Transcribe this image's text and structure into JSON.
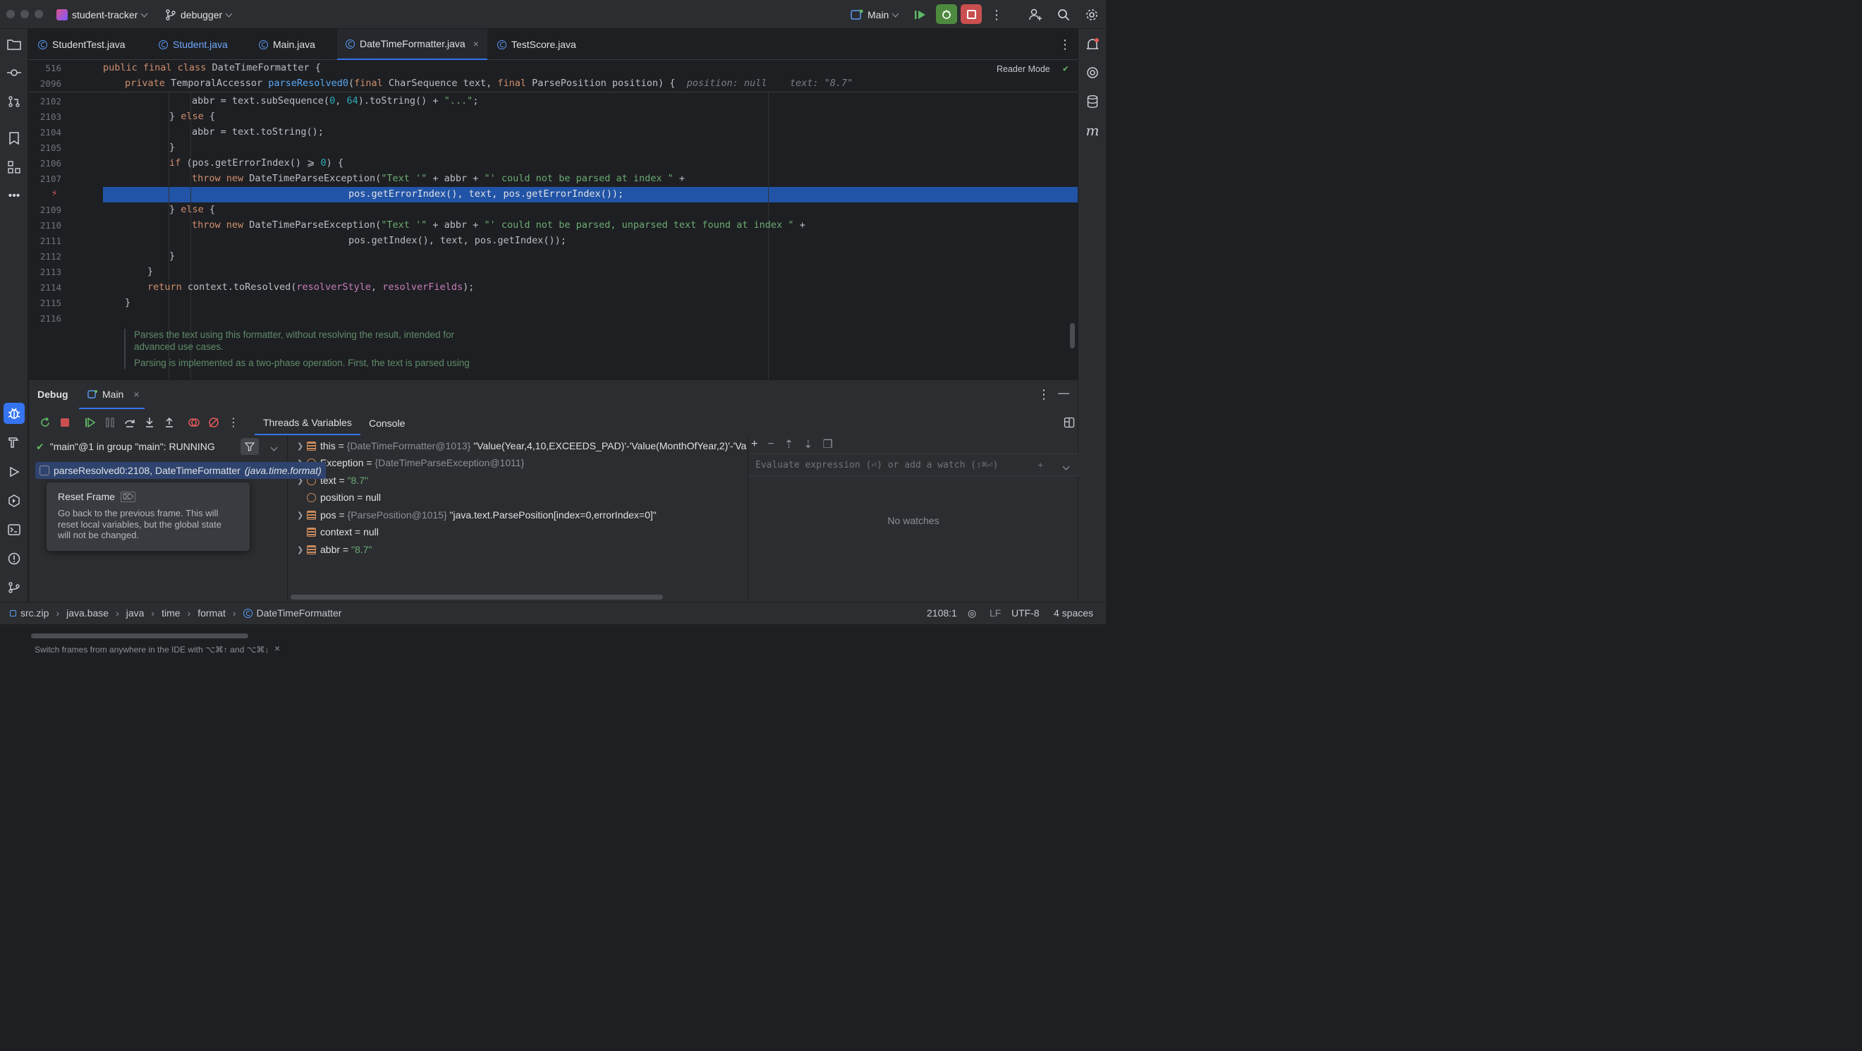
{
  "titlebar": {
    "project": "student-tracker",
    "branch": "debugger",
    "run_config": "Main"
  },
  "tabs": [
    {
      "label": "StudentTest.java",
      "active": false
    },
    {
      "label": "Student.java",
      "active": false
    },
    {
      "label": "Main.java",
      "active": false
    },
    {
      "label": "DateTimeFormatter.java",
      "active": true,
      "close": "×"
    },
    {
      "label": "TestScore.java",
      "active": false
    }
  ],
  "editor": {
    "reader_mode": "Reader Mode",
    "sticky": [
      {
        "ln": "516",
        "text": "public final class DateTimeFormatter {"
      },
      {
        "ln": "2096",
        "text": "private TemporalAccessor parseResolved0(final CharSequence text, final ParsePosition position) {",
        "hint_position": "position: null",
        "hint_text": "text: \"8.7\""
      }
    ],
    "lines": [
      {
        "ln": "2102",
        "text": "abbr = text.subSequence(0, 64).toString() + \"...\";"
      },
      {
        "ln": "2103",
        "text": "} else {"
      },
      {
        "ln": "2104",
        "text": "abbr = text.toString();"
      },
      {
        "ln": "2105",
        "text": "}"
      },
      {
        "ln": "2106",
        "text": "if (pos.getErrorIndex() ⩾ 0) {"
      },
      {
        "ln": "2107",
        "text": "throw new DateTimeParseException(\"Text '\" + abbr + \"' could not be parsed at index \" +"
      },
      {
        "ln": "",
        "text": "pos.getErrorIndex(), text, pos.getErrorIndex());"
      },
      {
        "ln": "2109",
        "text": "} else {"
      },
      {
        "ln": "2110",
        "text": "throw new DateTimeParseException(\"Text '\" + abbr + \"' could not be parsed, unparsed text found at index \" +"
      },
      {
        "ln": "2111",
        "text": "pos.getIndex(), text, pos.getIndex());"
      },
      {
        "ln": "2112",
        "text": "}"
      },
      {
        "ln": "2113",
        "text": "}"
      },
      {
        "ln": "2114",
        "text": "return context.toResolved(resolverStyle, resolverFields);"
      },
      {
        "ln": "2115",
        "text": "}"
      },
      {
        "ln": "2116",
        "text": ""
      }
    ],
    "doc_line1": "Parses the text using this formatter, without resolving the result, intended for",
    "doc_line2": "advanced use cases.",
    "doc_line3": "Parsing is implemented as a two-phase operation. First, the text is parsed using"
  },
  "debug": {
    "title": "Debug",
    "session_tab": "Main",
    "sub_tabs": [
      "Threads & Variables",
      "Console"
    ],
    "thread": "\"main\"@1 in group \"main\": RUNNING",
    "frame": "parseResolved0:2108, DateTimeFormatter",
    "frame_pkg": "(java.time.format)",
    "tooltip_title": "Reset Frame",
    "tooltip_body_1": "Go back to the previous frame. This will",
    "tooltip_body_2": "reset local variables, but the global state",
    "tooltip_body_3": "will not be changed.",
    "hint_footer": "Switch frames from anywhere in the IDE with ⌥⌘↑ and ⌥⌘↓",
    "variables": [
      {
        "name": "this",
        "type": "{DateTimeFormatter@1013}",
        "value": "\"Value(Year,4,10,EXCEEDS_PAD)'-'Value(MonthOfYear,2)'-'Va",
        "expandable": true,
        "kind": "field"
      },
      {
        "name": "Exception",
        "type": "{DateTimeParseException@1011}",
        "value": "",
        "expandable": true,
        "kind": "param"
      },
      {
        "name": "text",
        "type": "",
        "value": "\"8.7\"",
        "expandable": true,
        "kind": "param"
      },
      {
        "name": "position",
        "type": "",
        "value": "null",
        "expandable": false,
        "kind": "param"
      },
      {
        "name": "pos",
        "type": "{ParsePosition@1015}",
        "value": "\"java.text.ParsePosition[index=0,errorIndex=0]\"",
        "expandable": true,
        "kind": "field"
      },
      {
        "name": "context",
        "type": "",
        "value": "null",
        "expandable": false,
        "kind": "field"
      },
      {
        "name": "abbr",
        "type": "",
        "value": "\"8.7\"",
        "expandable": true,
        "kind": "field"
      }
    ],
    "watch_placeholder": "Evaluate expression (⏎) or add a watch (⇧⌘⏎)",
    "no_watches": "No watches"
  },
  "statusbar": {
    "breadcrumb": [
      "src.zip",
      "java.base",
      "java",
      "time",
      "format",
      "DateTimeFormatter"
    ],
    "position": "2108:1",
    "line_sep": "LF",
    "encoding": "UTF-8",
    "indent": "4 spaces"
  }
}
